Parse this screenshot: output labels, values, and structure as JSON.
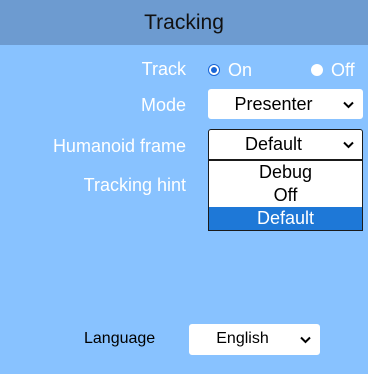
{
  "header": {
    "title": "Tracking"
  },
  "track": {
    "label": "Track",
    "options": [
      {
        "label": "On",
        "checked": true
      },
      {
        "label": "Off",
        "checked": false
      }
    ]
  },
  "mode": {
    "label": "Mode",
    "value": "Presenter"
  },
  "humanoid_frame": {
    "label": "Humanoid frame",
    "value": "Default",
    "options": [
      "Debug",
      "Off",
      "Default"
    ],
    "selected_option": "Default"
  },
  "tracking_hint": {
    "label": "Tracking hint"
  },
  "language": {
    "label": "Language",
    "value": "English"
  },
  "icons": {
    "chevron": "chevron-down-icon"
  },
  "colors": {
    "panel_bg": "#88c2ff",
    "header_bg": "#6d9bd0",
    "selected_option_bg": "#1e78d7",
    "radio_accent": "#1a66d6"
  }
}
